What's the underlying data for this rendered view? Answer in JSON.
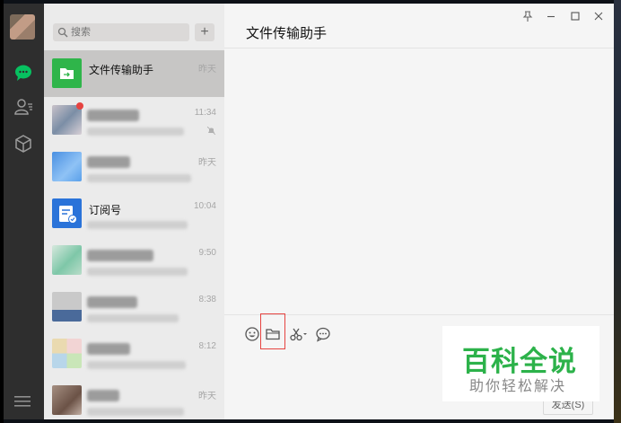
{
  "search": {
    "placeholder": "搜索"
  },
  "chat_list": [
    {
      "name": "文件传输助手",
      "time": "昨天",
      "active": true
    },
    {
      "name": "",
      "time": "11:34"
    },
    {
      "name": "",
      "time": "昨天"
    },
    {
      "name": "订阅号",
      "time": "10:04"
    },
    {
      "name": "",
      "time": "9:50"
    },
    {
      "name": "",
      "time": "8:38"
    },
    {
      "name": "",
      "time": "8:12"
    },
    {
      "name": "",
      "time": "昨天"
    }
  ],
  "chat": {
    "title": "文件传输助手"
  },
  "composer": {
    "send_label": "发送(S)"
  },
  "watermark": {
    "line1": "百科全说",
    "line2": "助你轻松解决"
  },
  "colors": {
    "accent_green": "#07c160",
    "highlight_red": "#e64340",
    "rail": "#2e2e2e",
    "watermark_green": "#2cb24a"
  },
  "icons": [
    "chat-icon",
    "contacts-icon",
    "favorites-cube-icon",
    "menu-icon",
    "search-icon",
    "emoji-icon",
    "folder-icon",
    "scissors-icon",
    "chat-history-icon",
    "pin-icon",
    "minimize-icon",
    "maximize-icon",
    "close-icon"
  ]
}
